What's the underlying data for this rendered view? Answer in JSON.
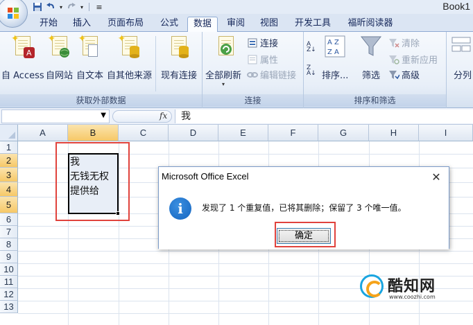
{
  "titlebar": {
    "document_title": "Book1"
  },
  "tabs": [
    {
      "label": "开始"
    },
    {
      "label": "插入"
    },
    {
      "label": "页面布局"
    },
    {
      "label": "公式"
    },
    {
      "label": "数据",
      "active": true
    },
    {
      "label": "审阅"
    },
    {
      "label": "视图"
    },
    {
      "label": "开发工具"
    },
    {
      "label": "福昕阅读器"
    }
  ],
  "ribbon": {
    "groups": {
      "external_data": {
        "label": "获取外部数据",
        "buttons": [
          "自 Access",
          "自网站",
          "自文本",
          "自其他来源",
          "现有连接"
        ]
      },
      "connections": {
        "label": "连接",
        "refresh_all": "全部刷新",
        "connections": "连接",
        "properties": "属性",
        "edit_links": "编辑链接"
      },
      "sort_filter": {
        "label": "排序和筛选",
        "sort": "排序...",
        "filter": "筛选",
        "clear": "清除",
        "reapply": "重新应用",
        "advanced": "高级"
      },
      "data_tools": {
        "split": "分列"
      }
    }
  },
  "formula_bar": {
    "fx": "fx",
    "content": "我"
  },
  "grid": {
    "columns": [
      "A",
      "B",
      "C",
      "D",
      "E",
      "F",
      "G",
      "H",
      "I"
    ],
    "selected_column": "B",
    "rows": [
      "1",
      "2",
      "3",
      "4",
      "5",
      "6",
      "7",
      "8",
      "9",
      "10",
      "11",
      "12",
      "13"
    ],
    "selected_rows": [
      "2",
      "3",
      "4",
      "5"
    ],
    "cells": {
      "B2": "我",
      "B3": "无钱无权",
      "B4": "提供给"
    }
  },
  "dialog": {
    "title": "Microsoft Office Excel",
    "icon": "info-icon",
    "message": "发现了 1 个重复值，已将其删除；保留了 3 个唯一值。",
    "ok_label": "确定"
  },
  "watermark": {
    "name": "酷知网",
    "url": "www.coozhi.com"
  },
  "colors": {
    "highlight_red": "#e0423c",
    "info_blue": "#1565c0",
    "selected_header": "#f6c867"
  }
}
